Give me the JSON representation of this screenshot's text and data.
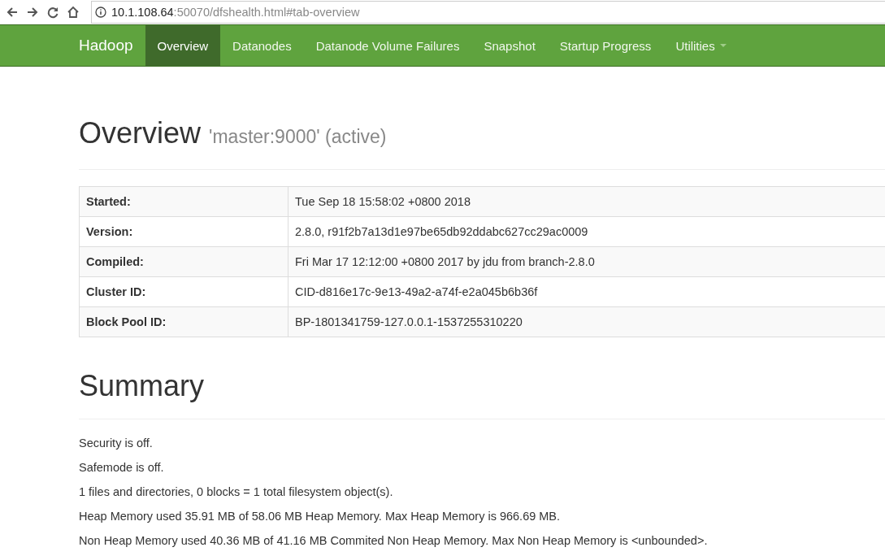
{
  "browser": {
    "url_host": "10.1.108.64",
    "url_path": ":50070/dfshealth.html#tab-overview"
  },
  "navbar": {
    "brand": "Hadoop",
    "items": [
      {
        "label": "Overview",
        "selected": true,
        "dropdown": false
      },
      {
        "label": "Datanodes",
        "selected": false,
        "dropdown": false
      },
      {
        "label": "Datanode Volume Failures",
        "selected": false,
        "dropdown": false
      },
      {
        "label": "Snapshot",
        "selected": false,
        "dropdown": false
      },
      {
        "label": "Startup Progress",
        "selected": false,
        "dropdown": false
      },
      {
        "label": "Utilities",
        "selected": false,
        "dropdown": true
      }
    ]
  },
  "overview": {
    "title": "Overview",
    "subtitle": "'master:9000' (active)",
    "rows": [
      {
        "label": "Started:",
        "value": "Tue Sep 18 15:58:02 +0800 2018"
      },
      {
        "label": "Version:",
        "value": "2.8.0, r91f2b7a13d1e97be65db92ddabc627cc29ac0009"
      },
      {
        "label": "Compiled:",
        "value": "Fri Mar 17 12:12:00 +0800 2017 by jdu from branch-2.8.0"
      },
      {
        "label": "Cluster ID:",
        "value": "CID-d816e17c-9e13-49a2-a74f-e2a045b6b36f"
      },
      {
        "label": "Block Pool ID:",
        "value": "BP-1801341759-127.0.0.1-1537255310220"
      }
    ]
  },
  "summary": {
    "title": "Summary",
    "lines": [
      "Security is off.",
      "Safemode is off.",
      "1 files and directories, 0 blocks = 1 total filesystem object(s).",
      "Heap Memory used 35.91 MB of 58.06 MB Heap Memory. Max Heap Memory is 966.69 MB.",
      "Non Heap Memory used 40.36 MB of 41.16 MB Commited Non Heap Memory. Max Non Heap Memory is <unbounded>."
    ]
  }
}
